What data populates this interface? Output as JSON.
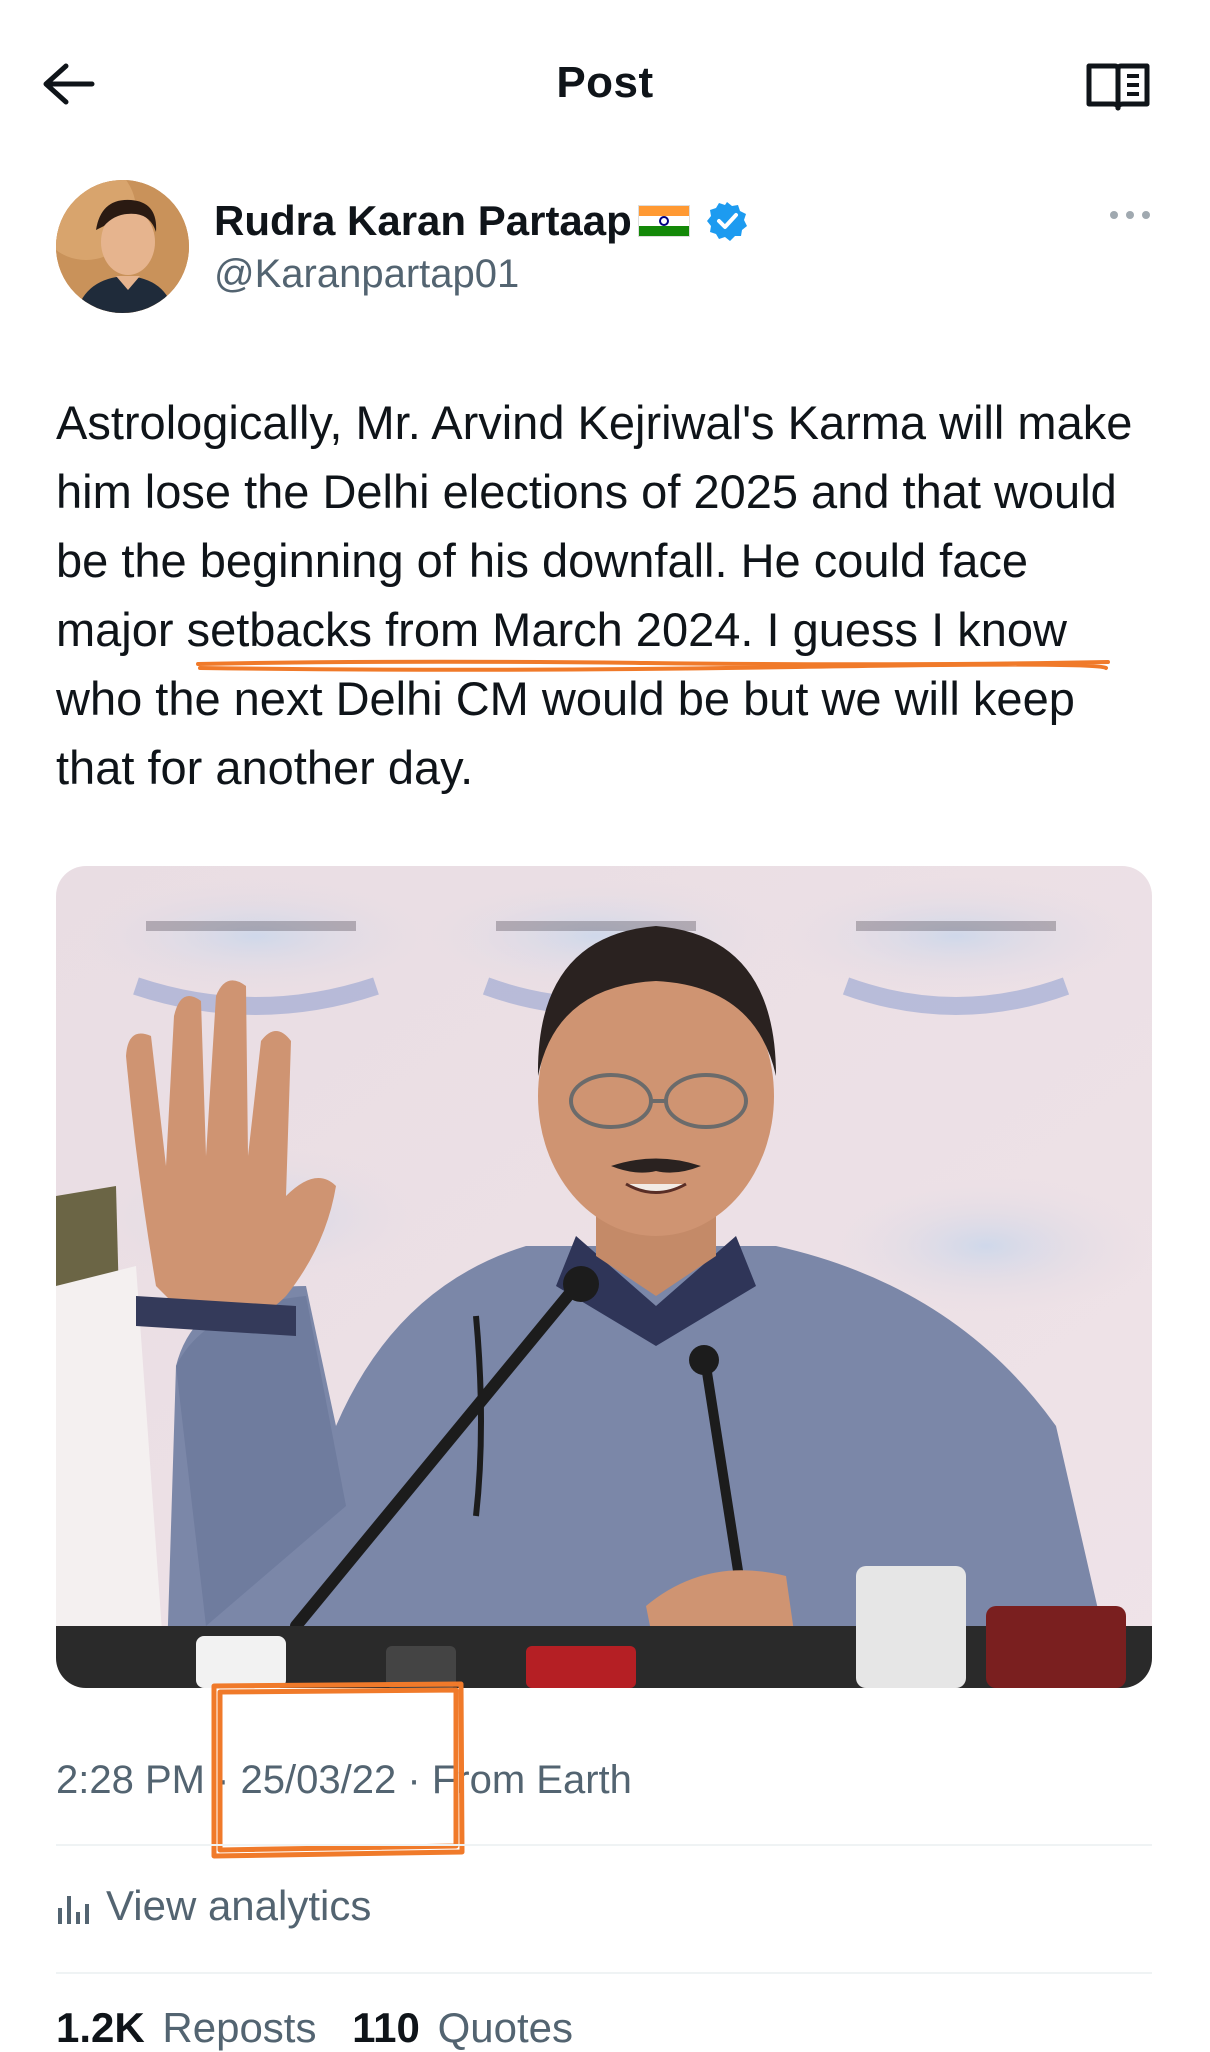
{
  "header": {
    "title": "Post"
  },
  "post": {
    "author": {
      "display_name": "Rudra Karan Partaap",
      "handle": "@Karanpartap01"
    },
    "text": "Astrologically, Mr. Arvind Kejriwal's Karma will make him lose the Delhi elections of 2025 and that would be the beginning of his downfall. He could face major setbacks from March 2024. I guess I know who the next Delhi CM would be but we will keep that for another day.",
    "meta": {
      "time": "2:28 PM",
      "sep": "·",
      "date": "25/03/22",
      "sep2": "·",
      "source": "From Earth"
    },
    "analytics_label": "View analytics",
    "stats": {
      "reposts_count": "1.2K",
      "reposts_label": "Reposts",
      "quotes_count": "110",
      "quotes_label": "Quotes"
    }
  },
  "colors": {
    "text": "#0f1419",
    "secondary": "#536471",
    "verified": "#1d9bf0",
    "annotation": "#f07a2a"
  },
  "icons": {
    "back": "arrow-left-icon",
    "reader": "reader-mode-icon",
    "more": "more-horizontal-icon",
    "verified": "verified-badge-icon",
    "analytics": "bar-chart-icon"
  }
}
